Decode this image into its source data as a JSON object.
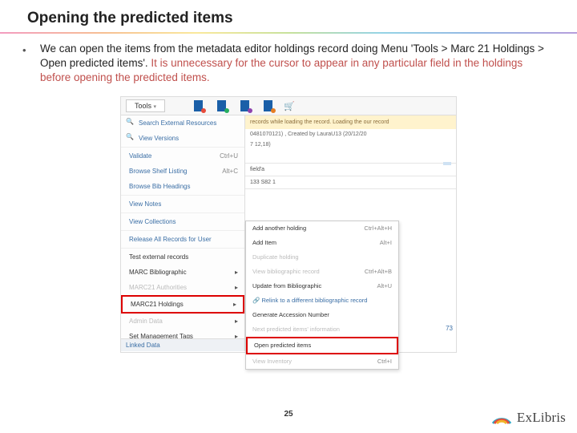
{
  "title": "Opening the predicted items",
  "bullet_text_plain": "We can open the items from the metadata editor holdings record doing Menu 'Tools > Marc 21 Holdings > Open predicted items'. ",
  "bullet_text_highlight": "It is unnecessary for the cursor to appear in any particular field in the holdings before opening the predicted items.",
  "page_number": "25",
  "logo_text": "ExLibris",
  "screenshot": {
    "tools_label": "Tools",
    "left_menu": {
      "search_ext": "Search External Resources",
      "view_versions": "View Versions",
      "validate": {
        "label": "Validate",
        "shortcut": "Ctrl+U"
      },
      "browse_shelf": {
        "label": "Browse Shelf Listing",
        "shortcut": "Alt+C"
      },
      "browse_bib": "Browse Bib Headings",
      "view_notes": "View Notes",
      "view_collections": "View Collections",
      "release_all": "Release All Records for User",
      "test_external": "Test external records",
      "marc_bib": "MARC Bibliographic",
      "marc21_auth": "MARC21 Authorities",
      "marc21_hold": "MARC21 Holdings",
      "admin_data": "Admin Data",
      "set_mgmt": "Set Management Tags",
      "linked_data": "Linked Data"
    },
    "right_panel": {
      "banner": "records while loading the record. Loading the our record",
      "info1": "0481070121) , Created by LauraU13 (20/12/20",
      "info2": "7 12,18)",
      "field_label_a": "field'a",
      "field_val": "133 S82 1",
      "count": "73"
    },
    "submenu": {
      "add_holding": {
        "label": "Add another holding",
        "shortcut": "Ctrl+Alt+H"
      },
      "add_item": {
        "label": "Add Item",
        "shortcut": "Alt+I"
      },
      "dup_holding": "Duplicate holding",
      "view_bib": {
        "label": "View bibliographic record",
        "shortcut": "Ctrl+Alt+B"
      },
      "update_bib": {
        "label": "Update from Bibliographic",
        "shortcut": "Alt+U"
      },
      "relink": "Relink to a different bibliographic record",
      "gen_acc": "Generate Accession Number",
      "next_pred": "Next predicted items' information",
      "open_pred": "Open predicted items",
      "view_inv": {
        "label": "View Inventory",
        "shortcut": "Ctrl+I"
      }
    }
  }
}
